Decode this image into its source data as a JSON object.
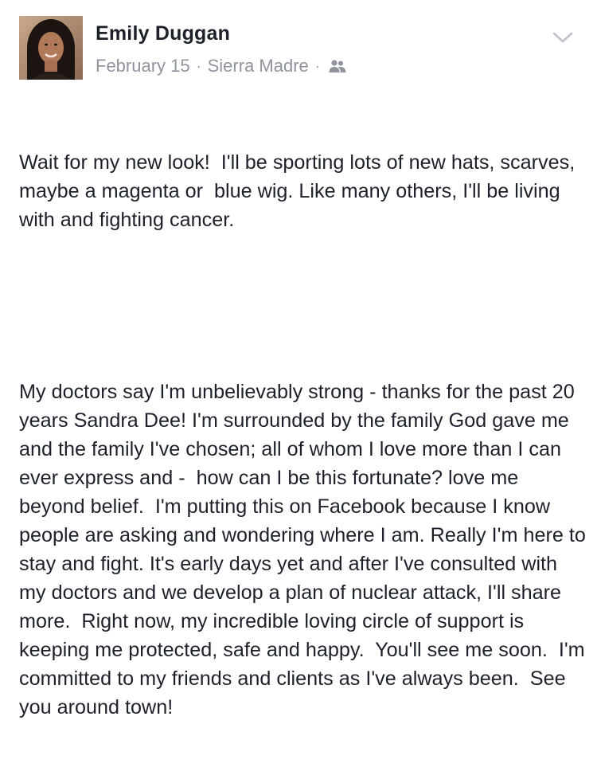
{
  "post": {
    "author": "Emily Duggan",
    "date": "February 15",
    "location": "Sierra Madre",
    "separator": "·",
    "audience_icon": "friends-icon",
    "menu_icon": "chevron-down-icon",
    "paragraphs": [
      "Wait for my new look!  I'll be sporting lots of new hats, scarves, maybe a magenta or  blue wig. Like many others, I'll be living with and fighting cancer.",
      "My doctors say I'm unbelievably strong - thanks for the past 20 years Sandra Dee! I'm surrounded by the family God gave me and the family I've chosen; all of whom I love more than I can ever express and -  how can I be this fortunate? love me beyond belief.  I'm putting this on Facebook because I know people are asking and wondering where I am. Really I'm here to stay and fight. It's early days yet and after I've consulted with my doctors and we develop a plan of nuclear attack, I'll share more.  Right now, my incredible loving circle of support is keeping me protected, safe and happy.  You'll see me soon.  I'm committed to my friends and clients as I've always been.  See you around town!"
    ]
  },
  "colors": {
    "text": "#1d2129",
    "meta": "#90949c",
    "chevron": "#bec2c9"
  }
}
